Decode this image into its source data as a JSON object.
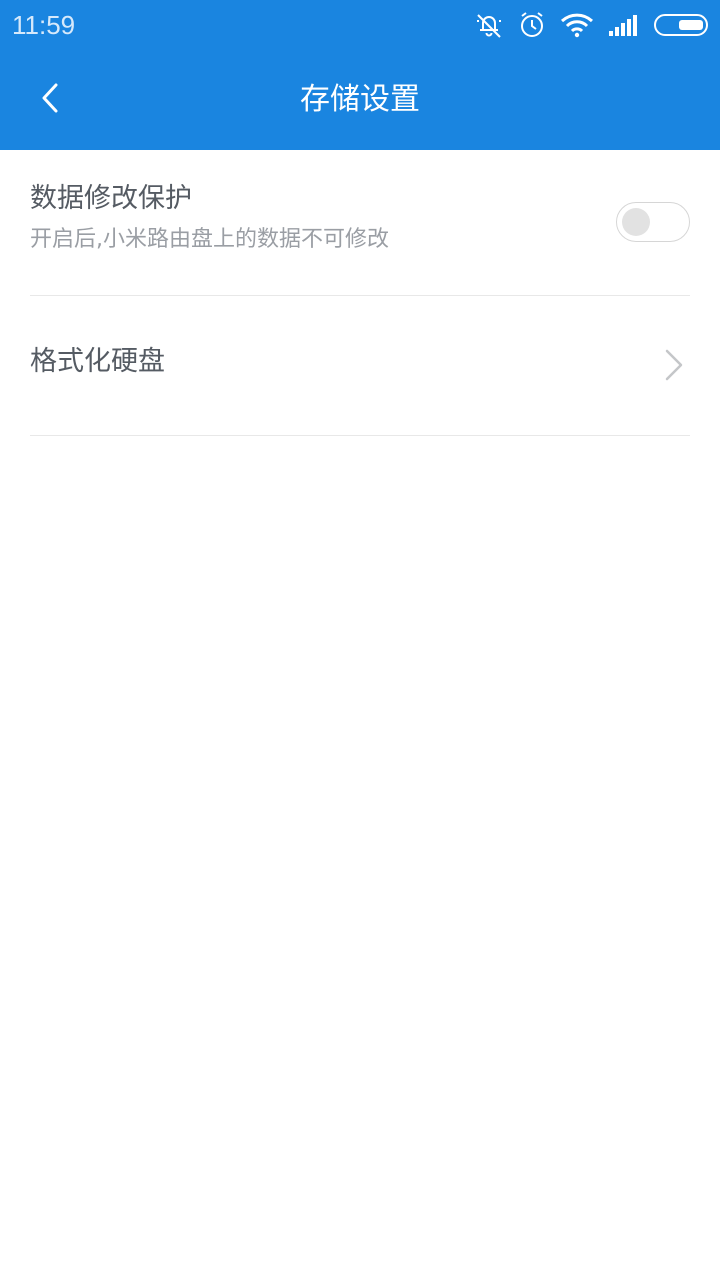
{
  "status_bar": {
    "time": "11:59",
    "icons": [
      "mute-icon",
      "alarm-icon",
      "wifi-icon",
      "signal-icon",
      "battery-icon"
    ]
  },
  "app_bar": {
    "title": "存储设置",
    "back_icon": "chevron-left-icon"
  },
  "settings": [
    {
      "title": "数据修改保护",
      "subtitle": "开启后,小米路由盘上的数据不可修改",
      "toggle_on": false
    },
    {
      "title": "格式化硬盘",
      "icon": "chevron-right-icon"
    }
  ],
  "colors": {
    "primary": "#1a85e0",
    "title_text": "#555b63",
    "subtitle_text": "#9a9ea4",
    "divider": "#e8e8e8"
  }
}
